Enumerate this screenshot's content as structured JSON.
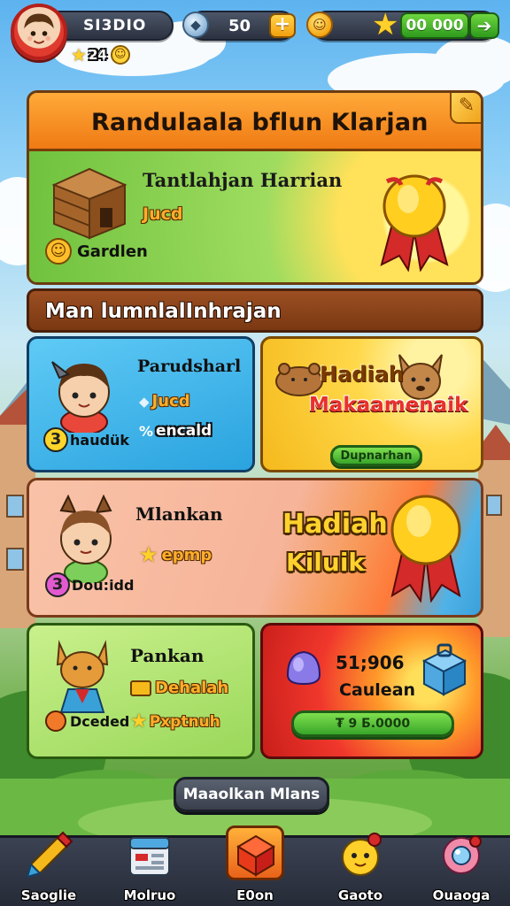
{
  "header": {
    "player_name": "SI3DIO",
    "player_stars": "24",
    "gems": "50",
    "coins_total": "00 000"
  },
  "daily_panel": {
    "title": "Randulaala bflun Klarjan",
    "task_title": "Tantlahjan Harrian",
    "task_status": "Jucd",
    "garden_label": "Gardlen"
  },
  "section_header": "Man lumnlalInhrajan",
  "cards": {
    "blue": {
      "title": "Parudsharl",
      "stat1": "Jucd",
      "stat2": "encald",
      "badge_num": "3",
      "badge_text": "haudük"
    },
    "yellow": {
      "title_line1": "Hadiah",
      "title_line2": "Makaamenaik",
      "button": "Dupnarhan"
    },
    "peach": {
      "title": "Mlankan",
      "stat": "epmp",
      "badge_num": "3",
      "badge_text": "Dou:idd",
      "reward_line1": "Hadiah",
      "reward_line2": "Kiluik"
    },
    "green_small": {
      "title": "Pankan",
      "stat1": "Dehalah",
      "stat2": "Pxptnuh",
      "badge_text": "Dceded"
    },
    "red": {
      "amount": "51;906",
      "label": "Caulean",
      "button": "₮ 9 Б.0000"
    }
  },
  "more_button": "Maaolkan Mlans",
  "bottom_nav": [
    {
      "label": "Saoglie",
      "icon": "pencil-icon"
    },
    {
      "label": "Molruo",
      "icon": "calendar-icon"
    },
    {
      "label": "E0on",
      "icon": "box-icon"
    },
    {
      "label": "Gaoto",
      "icon": "mascot-icon"
    },
    {
      "label": "Ouaoga",
      "icon": "orb-icon"
    }
  ],
  "colors": {
    "orange_header": "#f08a1c",
    "green_panel": "#9ad85a",
    "blue_card": "#46b6ea",
    "yellow_card": "#ffcc2a",
    "peach_card": "#f6b49a",
    "red_card": "#f0372c"
  }
}
